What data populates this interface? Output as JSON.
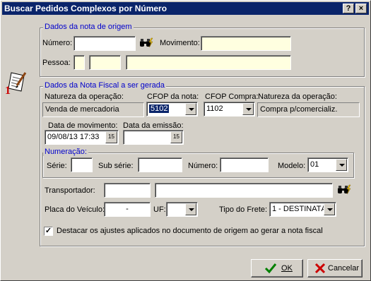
{
  "window": {
    "title": "Buscar Pedidos Complexos por Número",
    "help_glyph": "?",
    "close_glyph": "×"
  },
  "origem": {
    "legend": "Dados da nota de origem",
    "numero_label": "Número:",
    "numero_value": "",
    "movimento_label": "Movimento:",
    "movimento_value": "",
    "pessoa_label": "Pessoa:",
    "pessoa_code": "",
    "pessoa_id": "",
    "pessoa_name": ""
  },
  "nota": {
    "legend": "Dados da Nota Fiscal a ser gerada",
    "natureza1_label": "Natureza da operação:",
    "natureza1_value": "Venda de mercadoria",
    "cfop_nota_label": "CFOP da nota:",
    "cfop_nota_value": "5102",
    "cfop_compra_label": "CFOP Compra:",
    "cfop_compra_value": "1102",
    "natureza2_label": "Natureza da operação:",
    "natureza2_value": "Compra p/comercializ.",
    "data_mov_label": "Data de movimento:",
    "data_mov_value": "09/08/13 17:33",
    "data_emissao_label": "Data da emissão:",
    "data_emissao_value": "",
    "calendar_glyph": "15"
  },
  "numeracao": {
    "legend": "Numeração:",
    "serie_label": "Série:",
    "serie_value": "",
    "subserie_label": "Sub série:",
    "subserie_value": "",
    "numero_label": "Número:",
    "numero_value": "",
    "modelo_label": "Modelo:",
    "modelo_value": "01"
  },
  "transporte": {
    "transportador_label": "Transportador:",
    "transportador_code": "",
    "transportador_name": "",
    "placa_label": "Placa do Veículo:",
    "placa_value": "-",
    "uf_label": "UF:",
    "uf_value": "",
    "frete_label": "Tipo do Frete:",
    "frete_value": "1 - DESTINATÁ"
  },
  "destacar": {
    "checked": true,
    "check_glyph": "✓",
    "label": "Destacar os ajustes aplicados no documento de origem ao gerar a nota fiscal"
  },
  "buttons": {
    "ok_label": "OK",
    "cancel_label": "Cancelar"
  },
  "colors": {
    "title_bar": "#0a246a",
    "face": "#d4d0c8",
    "required_field": "#ffffe0",
    "group_label": "#0000cc"
  }
}
